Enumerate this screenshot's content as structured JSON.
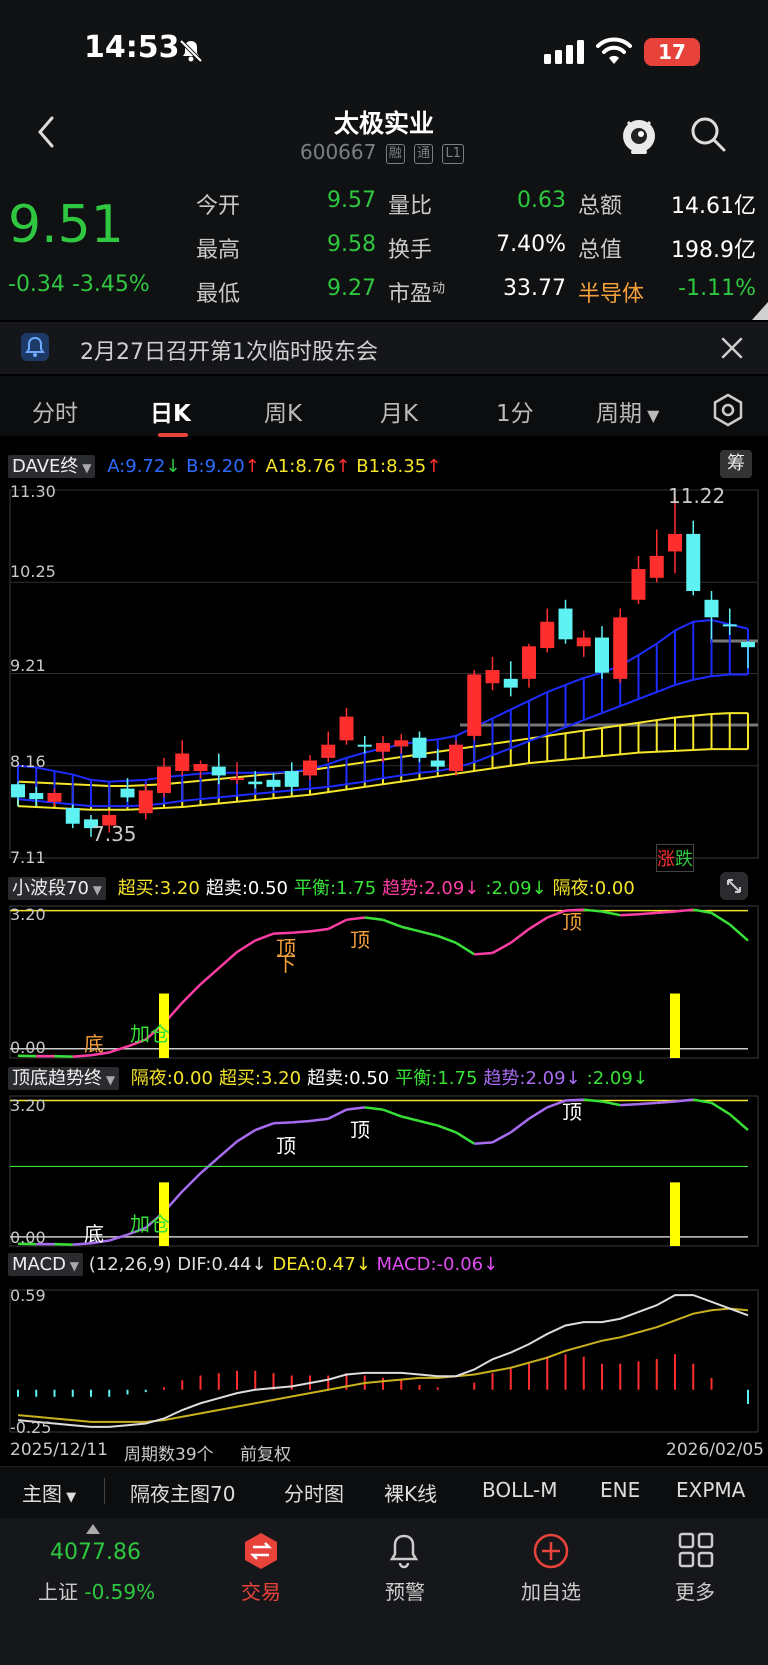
{
  "status_bar": {
    "time": "14:53",
    "battery": "17"
  },
  "header": {
    "title": "太极实业",
    "code": "600667",
    "tags": [
      "融",
      "通",
      "L1"
    ]
  },
  "quote": {
    "price": "9.51",
    "change": "-0.34",
    "change_pct": "-3.45%",
    "rows": [
      [
        {
          "label": "今开",
          "value": "9.57",
          "color": "#2fc740"
        },
        {
          "label": "量比",
          "value": "0.63",
          "color": "#2fc740"
        },
        {
          "label": "总额",
          "value": "14.61亿",
          "color": "#ffffff"
        }
      ],
      [
        {
          "label": "最高",
          "value": "9.58",
          "color": "#2fc740"
        },
        {
          "label": "换手",
          "value": "7.40%",
          "color": "#ffffff"
        },
        {
          "label": "总值",
          "value": "198.9亿",
          "color": "#ffffff"
        }
      ],
      [
        {
          "label": "最低",
          "value": "9.27",
          "color": "#2fc740"
        },
        {
          "label": "市盈",
          "sup": "动",
          "value": "33.77",
          "color": "#ffffff"
        },
        {
          "label": "半导体",
          "value": "-1.11%",
          "color": "#2fc740",
          "label_color": "#f3a03a"
        }
      ]
    ]
  },
  "notice": {
    "text": "2月27日召开第1次临时股东会"
  },
  "tabs": [
    {
      "label": "分时",
      "active": false
    },
    {
      "label": "日K",
      "active": true
    },
    {
      "label": "周K",
      "active": false
    },
    {
      "label": "月K",
      "active": false
    },
    {
      "label": "1分",
      "active": false
    },
    {
      "label": "周期",
      "active": false
    }
  ],
  "main_chart": {
    "indicator": "DAVE终",
    "a": "A:9.72",
    "b": "B:9.20",
    "a1": "A1:8.76",
    "b1": "B1:8.35",
    "y_labels": [
      "11.30",
      "10.25",
      "9.21",
      "8.16",
      "7.11"
    ],
    "high_label": "11.22",
    "low_label": "7.35",
    "badge_up": "涨",
    "badge_down": "跌",
    "side_badge": "筹"
  },
  "wave_panel": {
    "indicator": "小波段70",
    "items": [
      {
        "text": "超买:3.20",
        "color": "#f5e52a"
      },
      {
        "text": "超卖:0.50",
        "color": "#ffffff"
      },
      {
        "text": "平衡:1.75",
        "color": "#38e038"
      },
      {
        "text": "趋势:2.09↓",
        "color": "#ff3ea5"
      },
      {
        "text": ":2.09↓",
        "color": "#38e038"
      },
      {
        "text": "隔夜:0.00",
        "color": "#f5e52a"
      }
    ],
    "y_top": "3.20",
    "y_bottom": "0.00",
    "marks": {
      "bottom": "底",
      "add": "加仓",
      "top": "顶",
      "top_down": "顶\n下"
    }
  },
  "trend_panel": {
    "indicator": "顶底趋势终",
    "items": [
      {
        "text": "隔夜:0.00",
        "color": "#f5e52a"
      },
      {
        "text": "超买:3.20",
        "color": "#f5e52a"
      },
      {
        "text": "超卖:0.50",
        "color": "#ffffff"
      },
      {
        "text": "平衡:1.75",
        "color": "#38e038"
      },
      {
        "text": "趋势:2.09↓",
        "color": "#a86cf0"
      },
      {
        "text": ":2.09↓",
        "color": "#38e038"
      }
    ],
    "y_top": "3.20",
    "y_bottom": "0.00",
    "marks": {
      "bottom": "底",
      "add": "加仓",
      "top": "顶",
      "top_down": "顶"
    }
  },
  "macd_panel": {
    "indicator": "MACD",
    "params": "(12,26,9)",
    "dif": "DIF:0.44↓",
    "dea": "DEA:0.47↓",
    "macd": "MACD:-0.06↓",
    "y_top": "0.59",
    "y_bottom": "-0.25",
    "date_start": "2025/12/11",
    "period_count": "周期数39个",
    "adjust": "前复权",
    "date_end": "2026/02/05"
  },
  "toolbar": {
    "main_label": "主图",
    "items": [
      "隔夜主图70",
      "分时图",
      "裸K线",
      "BOLL-M",
      "ENE",
      "EXPMA"
    ]
  },
  "nav": {
    "index_value": "4077.86",
    "index_label": "上证",
    "index_change": "-0.59%",
    "items": [
      "交易",
      "预警",
      "加自选",
      "更多"
    ]
  },
  "chart_data": {
    "type": "candlestick",
    "x_range": [
      "2025/12/11",
      "2026/02/05"
    ],
    "ylim": [
      7.11,
      11.3
    ],
    "ohlc": [
      [
        7.95,
        7.98,
        7.7,
        7.8
      ],
      [
        7.85,
        7.92,
        7.7,
        7.78
      ],
      [
        7.75,
        7.9,
        7.7,
        7.85
      ],
      [
        7.68,
        7.72,
        7.45,
        7.5
      ],
      [
        7.55,
        7.6,
        7.35,
        7.45
      ],
      [
        7.48,
        7.65,
        7.4,
        7.6
      ],
      [
        7.9,
        8.02,
        7.75,
        7.8
      ],
      [
        7.62,
        7.95,
        7.55,
        7.88
      ],
      [
        7.85,
        8.25,
        7.8,
        8.15
      ],
      [
        8.1,
        8.45,
        8.05,
        8.3
      ],
      [
        8.1,
        8.22,
        8.02,
        8.18
      ],
      [
        8.15,
        8.3,
        7.95,
        8.05
      ],
      [
        8.0,
        8.2,
        7.95,
        8.02
      ],
      [
        7.98,
        8.1,
        7.9,
        7.95
      ],
      [
        8.0,
        8.08,
        7.88,
        7.92
      ],
      [
        8.1,
        8.2,
        7.85,
        7.92
      ],
      [
        8.05,
        8.28,
        8.0,
        8.22
      ],
      [
        8.25,
        8.55,
        8.2,
        8.4
      ],
      [
        8.45,
        8.82,
        8.4,
        8.72
      ],
      [
        8.4,
        8.5,
        8.3,
        8.38
      ],
      [
        8.32,
        8.5,
        8.2,
        8.42
      ],
      [
        8.38,
        8.52,
        8.3,
        8.45
      ],
      [
        8.48,
        8.55,
        8.2,
        8.25
      ],
      [
        8.22,
        8.35,
        8.1,
        8.15
      ],
      [
        8.1,
        8.45,
        8.05,
        8.4
      ],
      [
        8.5,
        9.25,
        8.45,
        9.2
      ],
      [
        9.1,
        9.4,
        9.02,
        9.25
      ],
      [
        9.15,
        9.35,
        8.95,
        9.05
      ],
      [
        9.15,
        9.55,
        9.05,
        9.52
      ],
      [
        9.5,
        9.95,
        9.45,
        9.8
      ],
      [
        9.95,
        10.05,
        9.55,
        9.6
      ],
      [
        9.52,
        9.7,
        9.4,
        9.62
      ],
      [
        9.62,
        9.75,
        9.15,
        9.22
      ],
      [
        9.15,
        9.95,
        9.1,
        9.85
      ],
      [
        10.05,
        10.55,
        10.0,
        10.4
      ],
      [
        10.3,
        10.85,
        10.25,
        10.55
      ],
      [
        10.6,
        11.22,
        10.35,
        10.8
      ],
      [
        10.8,
        10.95,
        10.1,
        10.15
      ],
      [
        10.05,
        10.15,
        9.6,
        9.85
      ],
      [
        9.77,
        9.95,
        9.65,
        9.75
      ],
      [
        9.57,
        9.58,
        9.27,
        9.51
      ]
    ],
    "band_upper": [
      8.16,
      8.14,
      8.1,
      8.06,
      8.0,
      7.98,
      7.99,
      8.0,
      8.03,
      8.05,
      8.07,
      8.08,
      8.08,
      8.08,
      8.08,
      8.09,
      8.12,
      8.18,
      8.25,
      8.31,
      8.36,
      8.4,
      8.44,
      8.46,
      8.5,
      8.6,
      8.7,
      8.8,
      8.9,
      9.0,
      9.08,
      9.16,
      9.22,
      9.3,
      9.42,
      9.55,
      9.7,
      9.8,
      9.82,
      9.77,
      9.72
    ],
    "band_lower": [
      7.78,
      7.76,
      7.74,
      7.72,
      7.7,
      7.7,
      7.7,
      7.71,
      7.73,
      7.76,
      7.78,
      7.8,
      7.82,
      7.84,
      7.86,
      7.88,
      7.9,
      7.92,
      7.95,
      7.98,
      8.02,
      8.05,
      8.08,
      8.1,
      8.14,
      8.2,
      8.28,
      8.36,
      8.44,
      8.52,
      8.6,
      8.68,
      8.76,
      8.84,
      8.92,
      9.0,
      9.08,
      9.14,
      9.18,
      9.2,
      9.2
    ],
    "band2_upper": [
      7.98,
      7.97,
      7.96,
      7.95,
      7.94,
      7.93,
      7.93,
      7.94,
      7.95,
      7.97,
      7.99,
      8.01,
      8.03,
      8.05,
      8.07,
      8.09,
      8.11,
      8.14,
      8.17,
      8.2,
      8.23,
      8.26,
      8.29,
      8.32,
      8.35,
      8.38,
      8.41,
      8.44,
      8.47,
      8.5,
      8.53,
      8.56,
      8.59,
      8.62,
      8.65,
      8.68,
      8.71,
      8.73,
      8.75,
      8.76,
      8.76
    ],
    "band2_lower": [
      7.7,
      7.69,
      7.68,
      7.67,
      7.66,
      7.66,
      7.66,
      7.67,
      7.68,
      7.69,
      7.71,
      7.73,
      7.75,
      7.77,
      7.79,
      7.81,
      7.83,
      7.86,
      7.89,
      7.92,
      7.95,
      7.98,
      8.01,
      8.04,
      8.07,
      8.1,
      8.13,
      8.16,
      8.19,
      8.21,
      8.23,
      8.25,
      8.27,
      8.29,
      8.31,
      8.32,
      8.33,
      8.34,
      8.35,
      8.35,
      8.35
    ],
    "wave": [
      0.05,
      0.04,
      0.04,
      0.03,
      0.06,
      0.12,
      0.25,
      0.4,
      0.75,
      1.2,
      1.6,
      1.95,
      2.3,
      2.55,
      2.7,
      2.72,
      2.75,
      2.8,
      3.0,
      3.05,
      3.0,
      2.85,
      2.75,
      2.65,
      2.5,
      2.25,
      2.28,
      2.5,
      2.8,
      3.05,
      3.2,
      3.22,
      3.18,
      3.1,
      3.12,
      3.15,
      3.18,
      3.22,
      3.15,
      2.9,
      2.55
    ],
    "macd_dif": [
      -0.18,
      -0.19,
      -0.2,
      -0.21,
      -0.22,
      -0.22,
      -0.21,
      -0.2,
      -0.17,
      -0.12,
      -0.08,
      -0.05,
      -0.02,
      0.0,
      0.01,
      0.02,
      0.04,
      0.06,
      0.09,
      0.1,
      0.1,
      0.1,
      0.09,
      0.08,
      0.08,
      0.12,
      0.18,
      0.22,
      0.27,
      0.33,
      0.38,
      0.4,
      0.4,
      0.42,
      0.46,
      0.5,
      0.56,
      0.56,
      0.52,
      0.48,
      0.44
    ],
    "macd_dea": [
      -0.15,
      -0.16,
      -0.17,
      -0.18,
      -0.19,
      -0.19,
      -0.19,
      -0.19,
      -0.18,
      -0.16,
      -0.14,
      -0.12,
      -0.1,
      -0.08,
      -0.06,
      -0.04,
      -0.02,
      0.0,
      0.02,
      0.04,
      0.05,
      0.06,
      0.07,
      0.07,
      0.08,
      0.09,
      0.11,
      0.13,
      0.16,
      0.19,
      0.23,
      0.26,
      0.29,
      0.31,
      0.34,
      0.37,
      0.41,
      0.45,
      0.47,
      0.48,
      0.47
    ],
    "macd_hist": [
      -0.03,
      -0.03,
      -0.03,
      -0.03,
      -0.03,
      -0.03,
      -0.02,
      -0.01,
      0.01,
      0.04,
      0.06,
      0.07,
      0.08,
      0.08,
      0.07,
      0.06,
      0.06,
      0.06,
      0.07,
      0.06,
      0.05,
      0.04,
      0.02,
      0.01,
      0.0,
      0.03,
      0.07,
      0.09,
      0.11,
      0.14,
      0.15,
      0.14,
      0.11,
      0.11,
      0.12,
      0.13,
      0.15,
      0.11,
      0.05,
      0.0,
      -0.06
    ]
  }
}
